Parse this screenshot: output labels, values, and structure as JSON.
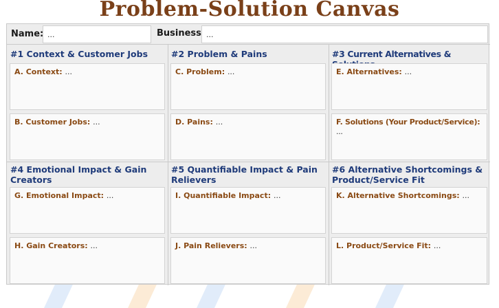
{
  "title": "Problem-Solution Canvas",
  "header": {
    "name_label": "Name:",
    "name_value": "...",
    "business_label": "Business:",
    "business_value": "..."
  },
  "sections": [
    {
      "num": "#1",
      "title": "Context & Customer Jobs",
      "boxes": [
        {
          "label": "A. Context:",
          "value": "..."
        },
        {
          "label": "B. Customer  Jobs:",
          "value": "..."
        }
      ]
    },
    {
      "num": "#2",
      "title": "Problem & Pains",
      "boxes": [
        {
          "label": "C. Problem:",
          "value": "..."
        },
        {
          "label": "D. Pains:",
          "value": "..."
        }
      ]
    },
    {
      "num": "#3",
      "title": "Current Alternatives & Solutions",
      "boxes": [
        {
          "label": "E. Alternatives:",
          "value": "..."
        },
        {
          "label": "F. Solutions (Your Product/Service):",
          "value": "..."
        }
      ]
    },
    {
      "num": "#4",
      "title": "Emotional Impact & Gain Creators",
      "boxes": [
        {
          "label": "G. Emotional Impact:",
          "value": "..."
        },
        {
          "label": "H. Gain Creators:",
          "value": "..."
        }
      ]
    },
    {
      "num": "#5",
      "title": "Quantifiable Impact & Pain Relievers",
      "boxes": [
        {
          "label": "I. Quantifiable Impact:",
          "value": "..."
        },
        {
          "label": "J. Pain Relievers:",
          "value": "..."
        }
      ]
    },
    {
      "num": "#6",
      "title": "Alternative Shortcomings & Product/Service Fit",
      "boxes": [
        {
          "label": "K. Alternative Shortcomings:",
          "value": "..."
        },
        {
          "label": "L. Product/Service Fit:",
          "value": "..."
        }
      ]
    }
  ],
  "colors": {
    "title": "#7a4019",
    "section_title": "#1f3b7a",
    "box_label": "#8a4a14"
  }
}
